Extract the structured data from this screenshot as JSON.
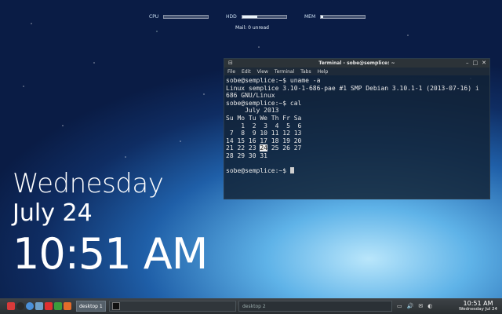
{
  "monitors": [
    {
      "label": "CPU",
      "fill": 0.0
    },
    {
      "label": "HDD",
      "fill": 0.35
    },
    {
      "label": "MEM",
      "fill": 0.05
    }
  ],
  "mail": "Mail: 0 unread",
  "clock_widget": {
    "day": "Wednesday",
    "date": "July 24",
    "time": "10:51 AM"
  },
  "terminal": {
    "title": "Terminal - sobe@semplice: ~",
    "menu": [
      "File",
      "Edit",
      "View",
      "Terminal",
      "Tabs",
      "Help"
    ],
    "lines": [
      "sobe@semplice:~$ uname -a",
      "Linux semplice 3.10-1-686-pae #1 SMP Debian 3.10.1-1 (2013-07-16) i",
      "686 GNU/Linux",
      "sobe@semplice:~$ cal",
      "     July 2013",
      "Su Mo Tu We Th Fr Sa",
      "    1  2  3  4  5  6",
      " 7  8  9 10 11 12 13",
      "14 15 16 17 18 19 20"
    ],
    "cal_line_pre": "21 22 23 ",
    "cal_highlight": "24",
    "cal_line_post": " 25 26 27",
    "last_cal": "28 29 30 31",
    "blank": "",
    "prompt": "sobe@semplice:~$ "
  },
  "taskbar": {
    "desktop1": "desktop 1",
    "desktop2": "desktop 2",
    "time": "10:51 AM",
    "date": "Wednesday Jul 24"
  },
  "colors": {
    "launcher": [
      "#d83a3a",
      "#2a2a2a",
      "#4a90d9",
      "#e36c2a",
      "#e03030",
      "#3c9c3c",
      "#6ea0c8"
    ]
  }
}
